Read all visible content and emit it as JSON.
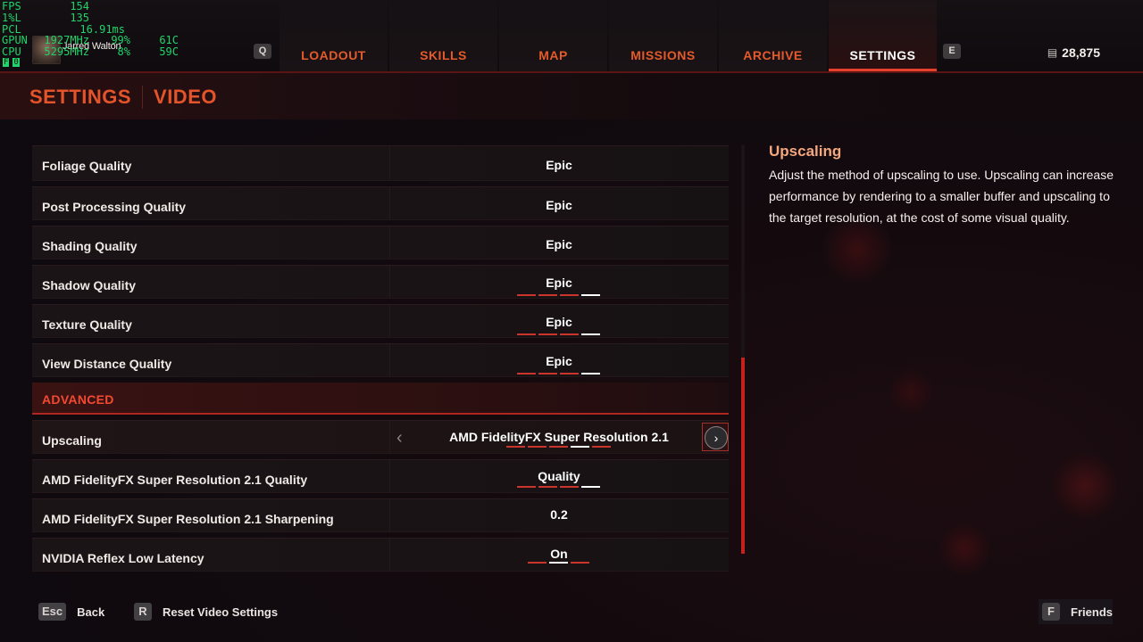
{
  "overlay": {
    "rows": [
      {
        "k": "FPS",
        "v1": "154",
        "v2": "",
        "v3": ""
      },
      {
        "k": "1%L",
        "v1": "135",
        "v2": "",
        "v3": ""
      },
      {
        "k": "PCL",
        "v1": "16.91ms",
        "v2": "",
        "v3": ""
      },
      {
        "k": "GPUN",
        "v1": "1927MHz",
        "v2": "99%",
        "v3": "61C"
      },
      {
        "k": "CPU",
        "v1": "5295MHz",
        "v2": "8%",
        "v3": "59C"
      }
    ],
    "flags": [
      "F",
      "0"
    ]
  },
  "player": {
    "name": "Jarred Walton"
  },
  "nav": {
    "prev_key": "Q",
    "next_key": "E",
    "tabs": [
      {
        "label": "LOADOUT"
      },
      {
        "label": "SKILLS"
      },
      {
        "label": "MAP"
      },
      {
        "label": "MISSIONS"
      },
      {
        "label": "ARCHIVE"
      },
      {
        "label": "SETTINGS",
        "active": true
      }
    ]
  },
  "currency": {
    "icon": "currency-icon",
    "amount": "28,875"
  },
  "breadcrumb": {
    "section": "SETTINGS",
    "page": "VIDEO"
  },
  "settings": [
    {
      "label": "Foliage Quality",
      "value": "Epic"
    },
    {
      "label": "Post Processing Quality",
      "value": "Epic"
    },
    {
      "label": "Shading Quality",
      "value": "Epic"
    },
    {
      "label": "Shadow Quality",
      "value": "Epic"
    },
    {
      "label": "Texture Quality",
      "value": "Epic"
    },
    {
      "label": "View Distance Quality",
      "value": "Epic"
    }
  ],
  "advanced": {
    "header": "ADVANCED",
    "rows": [
      {
        "label": "Upscaling",
        "value": "AMD FidelityFX Super Resolution 2.1"
      },
      {
        "label": "AMD FidelityFX Super Resolution 2.1 Quality",
        "value": "Quality"
      },
      {
        "label": "AMD FidelityFX Super Resolution 2.1 Sharpening",
        "value": "0.2"
      },
      {
        "label": "NVIDIA Reflex Low Latency",
        "value": "On"
      }
    ]
  },
  "description": {
    "title": "Upscaling",
    "body": "Adjust the method of upscaling to use.  Upscaling can increase performance by rendering to a smaller buffer and upscaling to the target resolution, at the cost of some visual quality."
  },
  "footer": {
    "back": {
      "key": "Esc",
      "label": "Back"
    },
    "reset": {
      "key": "R",
      "label": "Reset Video Settings"
    },
    "friends": {
      "key": "F",
      "label": "Friends"
    }
  },
  "colors": {
    "accent": "#e4542a",
    "active_underline": "#e4402b",
    "scroll_thumb": "#c5221b"
  }
}
